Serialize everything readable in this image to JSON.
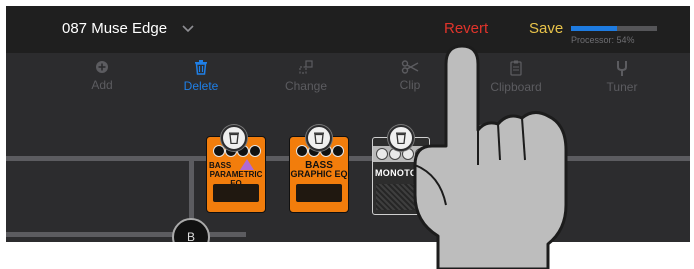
{
  "header": {
    "preset_name": "087 Muse Edge",
    "revert_label": "Revert",
    "save_label": "Save",
    "processor_text": "Processor: 54%",
    "processor_fraction": 0.54
  },
  "toolbar": {
    "items": [
      {
        "label": "Add",
        "icon": "plus-circle-icon",
        "active": false
      },
      {
        "label": "Delete",
        "icon": "trash-icon",
        "active": true
      },
      {
        "label": "Change",
        "icon": "swap-icon",
        "active": false
      },
      {
        "label": "Clip",
        "icon": "scissors-icon",
        "active": false
      },
      {
        "label": "Clipboard",
        "icon": "clipboard-icon",
        "active": false
      },
      {
        "label": "Tuner",
        "icon": "tuning-fork-icon",
        "active": false
      }
    ]
  },
  "pedals": [
    {
      "label": "BASS PARAMETRIC EQ",
      "line1": "BASS",
      "line2": "PARAMETRIC EQ",
      "color": "#f27d0c"
    },
    {
      "label": "BASS GRAPHIC EQ",
      "line1": "BASS",
      "line2": "GRAPHIC EQ",
      "color": "#f27d0c"
    },
    {
      "label": "MONOTON",
      "line1": "MONOTON",
      "line2": "",
      "color": "#2d2d2d"
    }
  ],
  "canvas": {
    "node_label": "B"
  },
  "colors": {
    "accent_blue": "#1f7fe6",
    "revert_red": "#e0342b",
    "save_yellow": "#e8c34a"
  }
}
